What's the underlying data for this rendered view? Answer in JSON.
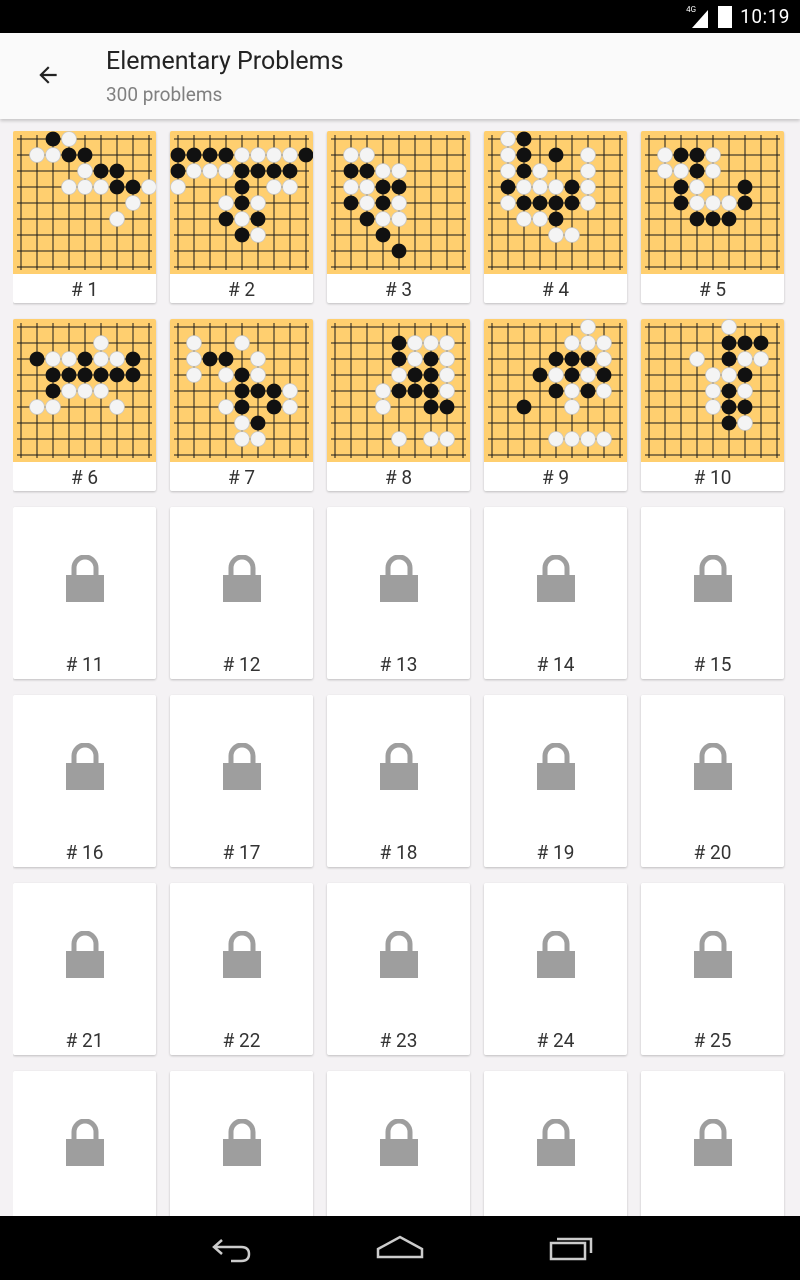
{
  "status": {
    "network": "4G",
    "time": "10:19"
  },
  "toolbar": {
    "title": "Elementary Problems",
    "subtitle": "300 problems"
  },
  "problems": [
    {
      "label": "# 1",
      "state": "solved"
    },
    {
      "label": "# 2",
      "state": "solved"
    },
    {
      "label": "# 3",
      "state": "solved"
    },
    {
      "label": "# 4",
      "state": "solved"
    },
    {
      "label": "# 5",
      "state": "solved"
    },
    {
      "label": "# 6",
      "state": "solved"
    },
    {
      "label": "# 7",
      "state": "solved"
    },
    {
      "label": "# 8",
      "state": "solved"
    },
    {
      "label": "# 9",
      "state": "solved"
    },
    {
      "label": "# 10",
      "state": "solved"
    },
    {
      "label": "# 11",
      "state": "locked"
    },
    {
      "label": "# 12",
      "state": "locked"
    },
    {
      "label": "# 13",
      "state": "locked"
    },
    {
      "label": "# 14",
      "state": "locked"
    },
    {
      "label": "# 15",
      "state": "locked"
    },
    {
      "label": "# 16",
      "state": "locked"
    },
    {
      "label": "# 17",
      "state": "locked"
    },
    {
      "label": "# 18",
      "state": "locked"
    },
    {
      "label": "# 19",
      "state": "locked"
    },
    {
      "label": "# 20",
      "state": "locked"
    },
    {
      "label": "# 21",
      "state": "locked"
    },
    {
      "label": "# 22",
      "state": "locked"
    },
    {
      "label": "# 23",
      "state": "locked"
    },
    {
      "label": "# 24",
      "state": "locked"
    },
    {
      "label": "# 25",
      "state": "locked"
    },
    {
      "label": "",
      "state": "locked"
    },
    {
      "label": "",
      "state": "locked"
    },
    {
      "label": "",
      "state": "locked"
    },
    {
      "label": "",
      "state": "locked"
    },
    {
      "label": "",
      "state": "locked"
    }
  ],
  "colors": {
    "board": "#ffcf6f",
    "lock": "#9e9e9e",
    "background": "#f4f2f4"
  },
  "icons": {
    "back": "arrow-back-icon",
    "lock": "lock-icon",
    "nav_back": "nav-back-icon",
    "nav_home": "nav-home-icon",
    "nav_recents": "nav-recents-icon"
  }
}
